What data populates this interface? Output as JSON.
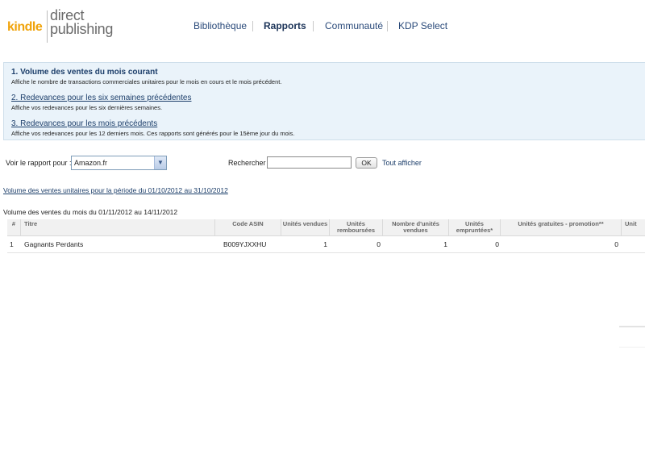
{
  "logo": {
    "brand": "kindle",
    "line1": "direct",
    "line2": "publishing"
  },
  "nav": {
    "items": [
      {
        "label": "Bibliothèque",
        "active": false
      },
      {
        "label": "Rapports",
        "active": true
      },
      {
        "label": "Communauté",
        "active": false
      },
      {
        "label": "KDP Select",
        "active": false
      }
    ]
  },
  "panel": {
    "items": [
      {
        "title": "1. Volume des ventes du mois courant",
        "desc": "Affiche le nombre de transactions commerciales unitaires pour le mois en cours et le mois précédent."
      },
      {
        "title": "2. Redevances pour les six semaines précédentes",
        "desc": "Affiche vos redevances pour les six dernières semaines."
      },
      {
        "title": "3. Redevances pour les mois précédents",
        "desc": "Affiche vos redevances pour les 12 derniers mois. Ces rapports sont générés pour le 15ème jour du mois."
      }
    ]
  },
  "filters": {
    "report_label": "Voir le rapport pour :",
    "report_value": "Amazon.fr",
    "search_label": "Rechercher",
    "search_value": "",
    "ok_label": "OK",
    "show_all_label": "Tout afficher"
  },
  "period_link": "Volume des ventes unitaires pour la période du 01/10/2012 au 31/10/2012",
  "report_caption": "Volume des ventes du mois du 01/11/2012 au 14/11/2012",
  "table": {
    "headers": {
      "num": "#",
      "title": "Titre",
      "asin": "Code ASIN",
      "sold": "Unités vendues",
      "refunded": "Unités remboursées",
      "net": "Nombre d'unités vendues",
      "borrowed": "Unités empruntées*",
      "free": "Unités gratuites - promotion**",
      "extra": "Unit"
    },
    "rows": [
      {
        "num": "1",
        "title": "Gagnants Perdants",
        "asin": "B009YJXXHU",
        "sold": "1",
        "refunded": "0",
        "net": "1",
        "borrowed": "0",
        "free": "0"
      }
    ]
  }
}
